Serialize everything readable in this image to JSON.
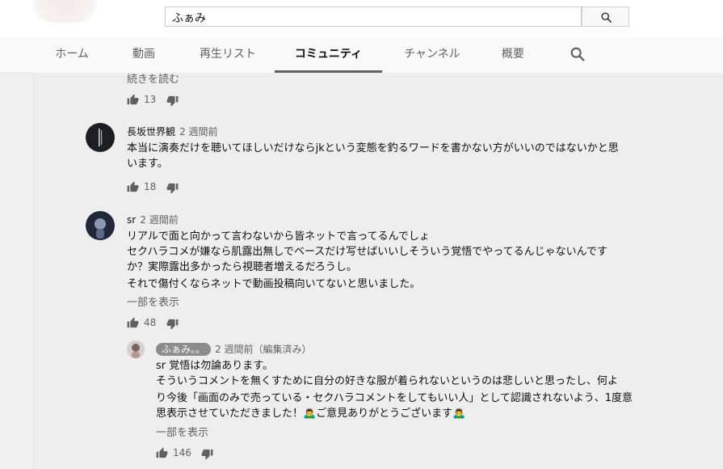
{
  "search": {
    "query": "ふぁみ"
  },
  "tabs": [
    {
      "label": "ホーム",
      "active": false
    },
    {
      "label": "動画",
      "active": false
    },
    {
      "label": "再生リスト",
      "active": false
    },
    {
      "label": "コミュニティ",
      "active": true
    },
    {
      "label": "チャンネル",
      "active": false
    },
    {
      "label": "概要",
      "active": false
    }
  ],
  "icons": {
    "search": "search-icon",
    "like": "thumb-up-icon",
    "dislike": "thumb-down-icon"
  },
  "comments": [
    {
      "read_more": "続きを読む",
      "likes": "13"
    },
    {
      "author": "長坂世界観",
      "time": "2 週間前",
      "lines": [
        "本当に演奏だけを聴いてほしいだけならjkという変態を釣るワードを書かない方がいいのではないかと思",
        "います。"
      ],
      "likes": "18"
    },
    {
      "author": "sr",
      "time": "2 週間前",
      "lines": [
        "リアルで面と向かって言わないから皆ネットで言ってるんでしょ",
        "セクハラコメが嫌なら肌露出無しでベースだけ写せばいいしそういう覚悟でやってるんじゃないんです",
        "か？実際露出多かったら視聴者増えるだろうし。",
        "それで傷付くならネットで動画投稿向いてないと思いました。"
      ],
      "show_part": "一部を表示",
      "likes": "48"
    },
    {
      "author": "ふぁみ。。",
      "time": "2 週間前（編集済み）",
      "lines": [
        "sr 覚悟は勿論あります。",
        "そういうコメントを無くすために自分の好きな服が着られないというのは悲しいと思ったし、何よ",
        "り今後「画面のみで売っている・セクハラコメントをしてもいい人」として認識されないよう、1度意",
        "思表示させていただきました！🙇‍♂️ご意見ありがとうございます🙇‍♂️"
      ],
      "show_part": "一部を表示",
      "likes": "146"
    }
  ],
  "colors": {
    "page_bg": "#f1f1f1",
    "panel_bg": "#eeeeee",
    "owner_badge": "#8c8c8c",
    "muted_text": "#606060"
  }
}
